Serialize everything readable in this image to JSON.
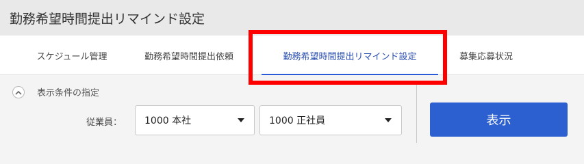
{
  "header": {
    "title": "勤務希望時間提出リマインド設定"
  },
  "tabs": [
    {
      "label": "スケジュール管理"
    },
    {
      "label": "勤務希望時間提出依頼"
    },
    {
      "label": "勤務希望時間提出リマインド設定",
      "active": true
    },
    {
      "label": "募集応募状況"
    }
  ],
  "filter": {
    "heading": "表示条件の指定",
    "toggle_icon": "chevron-up-icon",
    "employee_label": "従業員：",
    "store_select": {
      "value": "1000 本社"
    },
    "type_select": {
      "value": "1000 正社員"
    },
    "show_button": "表示"
  },
  "colors": {
    "accent": "#2c5fcf",
    "highlight": "#ff0000",
    "active_tab_underline": "#2a5bd7"
  }
}
